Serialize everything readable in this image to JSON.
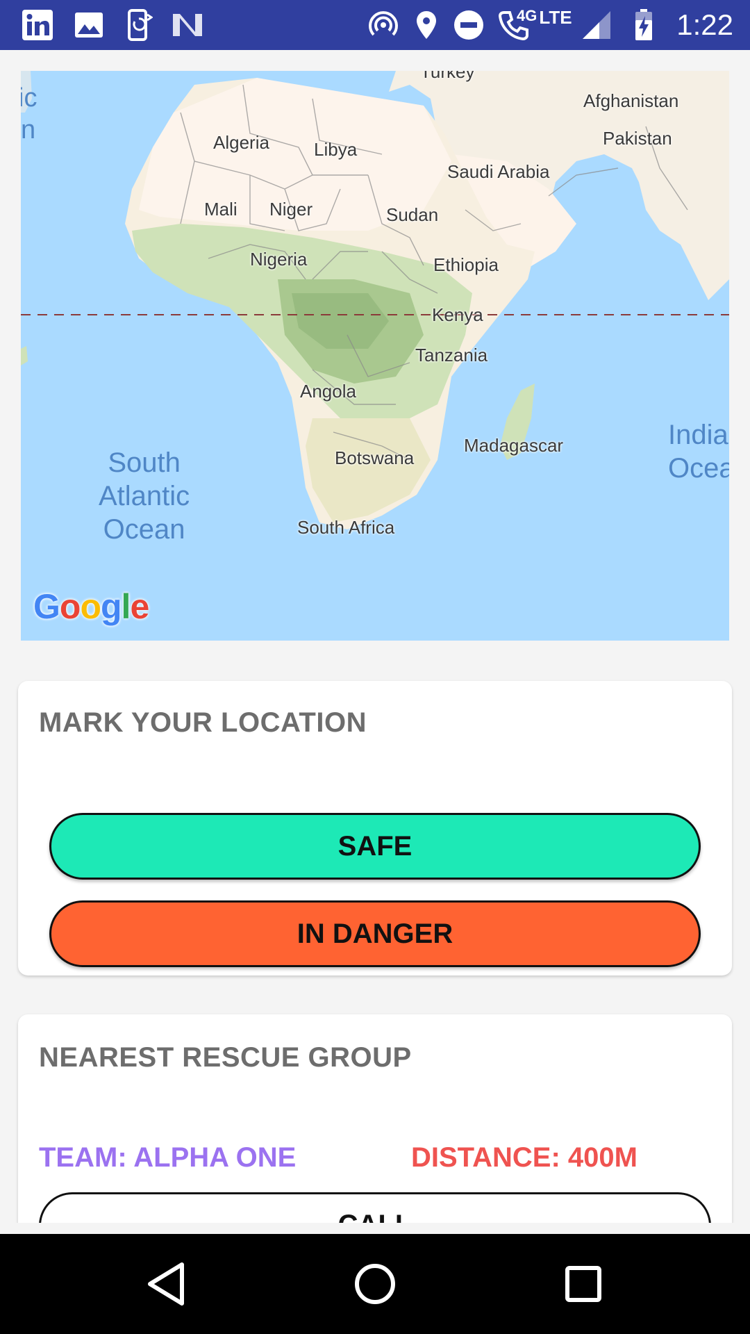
{
  "status_bar": {
    "time": "1:22",
    "network_type": "LTE",
    "network_small": "4G",
    "icons": [
      "linkedin-icon",
      "gallery-icon",
      "phone-sync-icon",
      "n-logo-icon",
      "hotspot-icon",
      "location-icon",
      "do-not-disturb-icon",
      "wifi-calling-icon",
      "signal-icon",
      "battery-charging-icon"
    ]
  },
  "map": {
    "labels": {
      "algeria": "Algeria",
      "libya": "Libya",
      "mali": "Mali",
      "niger": "Niger",
      "sudan": "Sudan",
      "nigeria": "Nigeria",
      "ethiopia": "Ethiopia",
      "kenya": "Kenya",
      "tanzania": "Tanzania",
      "angola": "Angola",
      "botswana": "Botswana",
      "south_africa": "South Africa",
      "madagascar": "Madagascar",
      "saudi_arabia": "Saudi Arabia",
      "afghanistan": "Afghanistan",
      "pakistan": "Pakistan",
      "turkey": "Turkey",
      "edge_left_1": "ic",
      "edge_left_2": "n"
    },
    "oceans": {
      "south_atlantic_1": "South",
      "south_atlantic_2": "Atlantic",
      "south_atlantic_3": "Ocean",
      "indian_1": "India",
      "indian_2": "Ocea"
    },
    "google_logo": "Google"
  },
  "mark_location": {
    "title": "MARK YOUR LOCATION",
    "safe_label": "SAFE",
    "danger_label": "IN DANGER",
    "safe_color": "#1de9b6",
    "danger_color": "#ff6332"
  },
  "rescue_group": {
    "title": "NEAREST RESCUE GROUP",
    "team": "TEAM: ALPHA ONE",
    "distance": "DISTANCE: 400M",
    "call_label": "CALL"
  },
  "nav": {
    "icons": [
      "back-icon",
      "home-icon",
      "recents-icon"
    ]
  }
}
